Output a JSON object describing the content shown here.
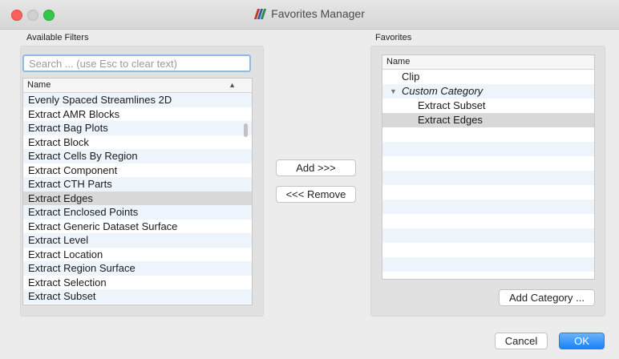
{
  "window": {
    "title": "Favorites Manager"
  },
  "available": {
    "label": "Available Filters",
    "search_placeholder": "Search ... (use Esc to clear text)",
    "column_header": "Name",
    "items": [
      "Evenly Spaced Streamlines 2D",
      "Extract AMR Blocks",
      "Extract Bag Plots",
      "Extract Block",
      "Extract Cells By Region",
      "Extract Component",
      "Extract CTH Parts",
      "Extract Edges",
      "Extract Enclosed Points",
      "Extract Generic Dataset Surface",
      "Extract Level",
      "Extract Location",
      "Extract Region Surface",
      "Extract Selection",
      "Extract Subset"
    ],
    "selected": "Extract Edges"
  },
  "buttons": {
    "add": "Add >>>",
    "remove": "<<< Remove",
    "add_category": "Add Category ...",
    "cancel": "Cancel",
    "ok": "OK"
  },
  "favorites": {
    "label": "Favorites",
    "column_header": "Name",
    "items": [
      {
        "label": "Clip",
        "level": 0
      },
      {
        "label": "Custom Category",
        "level": 0,
        "category": true,
        "expanded": true
      },
      {
        "label": "Extract Subset",
        "level": 1
      },
      {
        "label": "Extract Edges",
        "level": 1,
        "selected": true
      }
    ]
  },
  "colors": {
    "accent": "#1a82fb",
    "selection": "#d8d8d8",
    "row_alt": "#eef4fc"
  }
}
